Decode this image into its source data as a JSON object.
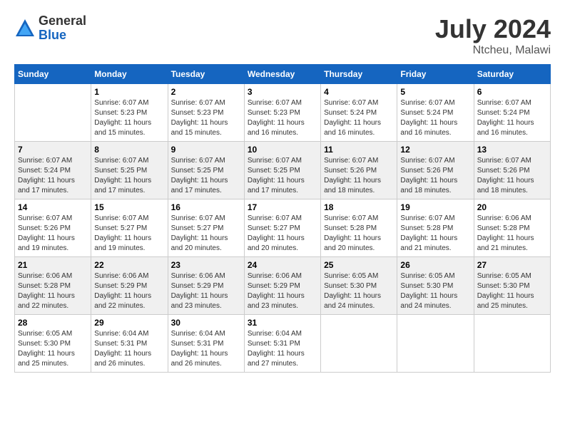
{
  "logo": {
    "general": "General",
    "blue": "Blue"
  },
  "title": {
    "month_year": "July 2024",
    "location": "Ntcheu, Malawi"
  },
  "weekdays": [
    "Sunday",
    "Monday",
    "Tuesday",
    "Wednesday",
    "Thursday",
    "Friday",
    "Saturday"
  ],
  "weeks": [
    [
      {
        "day": "",
        "sunrise": "",
        "sunset": "",
        "daylight": ""
      },
      {
        "day": "1",
        "sunrise": "Sunrise: 6:07 AM",
        "sunset": "Sunset: 5:23 PM",
        "daylight": "Daylight: 11 hours and 15 minutes."
      },
      {
        "day": "2",
        "sunrise": "Sunrise: 6:07 AM",
        "sunset": "Sunset: 5:23 PM",
        "daylight": "Daylight: 11 hours and 15 minutes."
      },
      {
        "day": "3",
        "sunrise": "Sunrise: 6:07 AM",
        "sunset": "Sunset: 5:23 PM",
        "daylight": "Daylight: 11 hours and 16 minutes."
      },
      {
        "day": "4",
        "sunrise": "Sunrise: 6:07 AM",
        "sunset": "Sunset: 5:24 PM",
        "daylight": "Daylight: 11 hours and 16 minutes."
      },
      {
        "day": "5",
        "sunrise": "Sunrise: 6:07 AM",
        "sunset": "Sunset: 5:24 PM",
        "daylight": "Daylight: 11 hours and 16 minutes."
      },
      {
        "day": "6",
        "sunrise": "Sunrise: 6:07 AM",
        "sunset": "Sunset: 5:24 PM",
        "daylight": "Daylight: 11 hours and 16 minutes."
      }
    ],
    [
      {
        "day": "7",
        "sunrise": "Sunrise: 6:07 AM",
        "sunset": "Sunset: 5:24 PM",
        "daylight": "Daylight: 11 hours and 17 minutes."
      },
      {
        "day": "8",
        "sunrise": "Sunrise: 6:07 AM",
        "sunset": "Sunset: 5:25 PM",
        "daylight": "Daylight: 11 hours and 17 minutes."
      },
      {
        "day": "9",
        "sunrise": "Sunrise: 6:07 AM",
        "sunset": "Sunset: 5:25 PM",
        "daylight": "Daylight: 11 hours and 17 minutes."
      },
      {
        "day": "10",
        "sunrise": "Sunrise: 6:07 AM",
        "sunset": "Sunset: 5:25 PM",
        "daylight": "Daylight: 11 hours and 17 minutes."
      },
      {
        "day": "11",
        "sunrise": "Sunrise: 6:07 AM",
        "sunset": "Sunset: 5:26 PM",
        "daylight": "Daylight: 11 hours and 18 minutes."
      },
      {
        "day": "12",
        "sunrise": "Sunrise: 6:07 AM",
        "sunset": "Sunset: 5:26 PM",
        "daylight": "Daylight: 11 hours and 18 minutes."
      },
      {
        "day": "13",
        "sunrise": "Sunrise: 6:07 AM",
        "sunset": "Sunset: 5:26 PM",
        "daylight": "Daylight: 11 hours and 18 minutes."
      }
    ],
    [
      {
        "day": "14",
        "sunrise": "Sunrise: 6:07 AM",
        "sunset": "Sunset: 5:26 PM",
        "daylight": "Daylight: 11 hours and 19 minutes."
      },
      {
        "day": "15",
        "sunrise": "Sunrise: 6:07 AM",
        "sunset": "Sunset: 5:27 PM",
        "daylight": "Daylight: 11 hours and 19 minutes."
      },
      {
        "day": "16",
        "sunrise": "Sunrise: 6:07 AM",
        "sunset": "Sunset: 5:27 PM",
        "daylight": "Daylight: 11 hours and 20 minutes."
      },
      {
        "day": "17",
        "sunrise": "Sunrise: 6:07 AM",
        "sunset": "Sunset: 5:27 PM",
        "daylight": "Daylight: 11 hours and 20 minutes."
      },
      {
        "day": "18",
        "sunrise": "Sunrise: 6:07 AM",
        "sunset": "Sunset: 5:28 PM",
        "daylight": "Daylight: 11 hours and 20 minutes."
      },
      {
        "day": "19",
        "sunrise": "Sunrise: 6:07 AM",
        "sunset": "Sunset: 5:28 PM",
        "daylight": "Daylight: 11 hours and 21 minutes."
      },
      {
        "day": "20",
        "sunrise": "Sunrise: 6:06 AM",
        "sunset": "Sunset: 5:28 PM",
        "daylight": "Daylight: 11 hours and 21 minutes."
      }
    ],
    [
      {
        "day": "21",
        "sunrise": "Sunrise: 6:06 AM",
        "sunset": "Sunset: 5:28 PM",
        "daylight": "Daylight: 11 hours and 22 minutes."
      },
      {
        "day": "22",
        "sunrise": "Sunrise: 6:06 AM",
        "sunset": "Sunset: 5:29 PM",
        "daylight": "Daylight: 11 hours and 22 minutes."
      },
      {
        "day": "23",
        "sunrise": "Sunrise: 6:06 AM",
        "sunset": "Sunset: 5:29 PM",
        "daylight": "Daylight: 11 hours and 23 minutes."
      },
      {
        "day": "24",
        "sunrise": "Sunrise: 6:06 AM",
        "sunset": "Sunset: 5:29 PM",
        "daylight": "Daylight: 11 hours and 23 minutes."
      },
      {
        "day": "25",
        "sunrise": "Sunrise: 6:05 AM",
        "sunset": "Sunset: 5:30 PM",
        "daylight": "Daylight: 11 hours and 24 minutes."
      },
      {
        "day": "26",
        "sunrise": "Sunrise: 6:05 AM",
        "sunset": "Sunset: 5:30 PM",
        "daylight": "Daylight: 11 hours and 24 minutes."
      },
      {
        "day": "27",
        "sunrise": "Sunrise: 6:05 AM",
        "sunset": "Sunset: 5:30 PM",
        "daylight": "Daylight: 11 hours and 25 minutes."
      }
    ],
    [
      {
        "day": "28",
        "sunrise": "Sunrise: 6:05 AM",
        "sunset": "Sunset: 5:30 PM",
        "daylight": "Daylight: 11 hours and 25 minutes."
      },
      {
        "day": "29",
        "sunrise": "Sunrise: 6:04 AM",
        "sunset": "Sunset: 5:31 PM",
        "daylight": "Daylight: 11 hours and 26 minutes."
      },
      {
        "day": "30",
        "sunrise": "Sunrise: 6:04 AM",
        "sunset": "Sunset: 5:31 PM",
        "daylight": "Daylight: 11 hours and 26 minutes."
      },
      {
        "day": "31",
        "sunrise": "Sunrise: 6:04 AM",
        "sunset": "Sunset: 5:31 PM",
        "daylight": "Daylight: 11 hours and 27 minutes."
      },
      {
        "day": "",
        "sunrise": "",
        "sunset": "",
        "daylight": ""
      },
      {
        "day": "",
        "sunrise": "",
        "sunset": "",
        "daylight": ""
      },
      {
        "day": "",
        "sunrise": "",
        "sunset": "",
        "daylight": ""
      }
    ]
  ]
}
